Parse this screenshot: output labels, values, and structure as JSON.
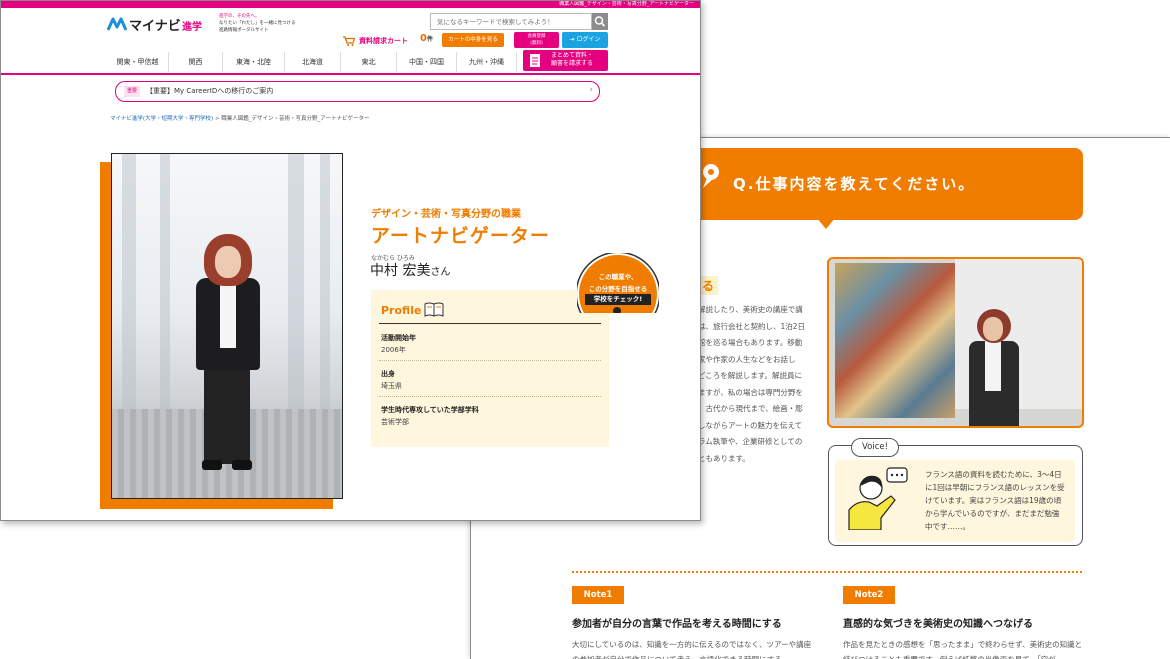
{
  "back_page": {
    "question": "Q.仕事内容を教えてください。",
    "heading_fragment": "る",
    "body_lines": [
      "解説したり、美術史の講座で講",
      "は、旅行会社と契約し、1泊2日",
      "館を巡る場合もあります。移動",
      "家や作家の人生などをお話し",
      "どころを解説します。解説員に",
      "ますが、私の場合は専門分野を",
      "。古代から現代まで、絵画・彫",
      "しながらアートの魅力を伝えて",
      "ラム執筆や、企業研修としての",
      "ともあります。"
    ],
    "voice": {
      "tag": "Voice!",
      "text": "フランス語の資料を読むために、3〜4日に1回は早朝にフランス語のレッスンを受けています。実はフランス語は19歳の頃から学んでいるのですが、まだまだ勉強中です……。"
    },
    "notes": [
      {
        "badge": "Note1",
        "title": "参加者が自分の言葉で作品を考える時間にする",
        "body": "大切にしているのは、知識を一方的に伝えるのではなく、ツアーや講座の参加者が自分で作品について考え、言語化できる時間にする"
      },
      {
        "badge": "Note2",
        "title": "直感的な気づきを美術史の知識へつなげる",
        "body": "作品を見たときの感想を「思ったまま」で終わらせず、美術史の知識と結びつけることも重要です。例えば紙幣の肖像画を見て、「空が"
      }
    ]
  },
  "front_page": {
    "top_strip": "職業人図鑑_デザイン・芸術・写真分野_アートナビゲーター",
    "logo": {
      "brand": "マイナビ",
      "suffix": "進学",
      "tagline": [
        "進学の、その先へ。",
        "なりたい「わたし」を一緒に見つける",
        "進路情報ポータルサイト"
      ]
    },
    "search": {
      "placeholder": "気になるキーワードで検索してみよう！"
    },
    "cart": {
      "label": "資料請求カート",
      "count": "0",
      "count_unit": "件",
      "button": "カートの中身を見る"
    },
    "member_button": [
      "会員登録",
      "(無料)"
    ],
    "login_button": "ログイン",
    "regions": [
      "関東・甲信越",
      "関西",
      "東海・北陸",
      "北海道",
      "東北",
      "中国・四国",
      "九州・沖縄"
    ],
    "request_button": [
      "まとめて資料・",
      "願書を請求する"
    ],
    "notice": {
      "tag": "重要",
      "text": "【重要】My CareerIDへの移行のご案内",
      "chevron": "›"
    },
    "breadcrumb": {
      "link": "マイナビ進学(大学・短期大学・専門学校)",
      "separator": ">",
      "current": "職業人図鑑_デザイン・芸術・写真分野_アートナビゲーター"
    },
    "field_label": "デザイン・芸術・写真分野の職業",
    "job_title": "アートナビゲーター",
    "ruby": "なかむら ひろみ",
    "name": "中村 宏美",
    "honorific": "さん",
    "badge": [
      "この職業や、",
      "この分野を目指せる",
      "学校をチェック!"
    ],
    "profile": {
      "title": "Profile",
      "items": [
        {
          "label": "活動開始年",
          "value": "2006年"
        },
        {
          "label": "出身",
          "value": "埼玉県"
        },
        {
          "label": "学生時代専攻していた学部学科",
          "value": "芸術学部"
        }
      ]
    }
  },
  "colors": {
    "accent_orange": "#f07d00",
    "brand_pink": "#e4007f",
    "login_blue": "#1aa3e0",
    "profile_bg": "#fff6de"
  },
  "icons": [
    "chat-bubble-icon",
    "search-icon",
    "cart-icon",
    "login-icon",
    "document-icon",
    "book-icon",
    "speech-bubble-icon"
  ]
}
